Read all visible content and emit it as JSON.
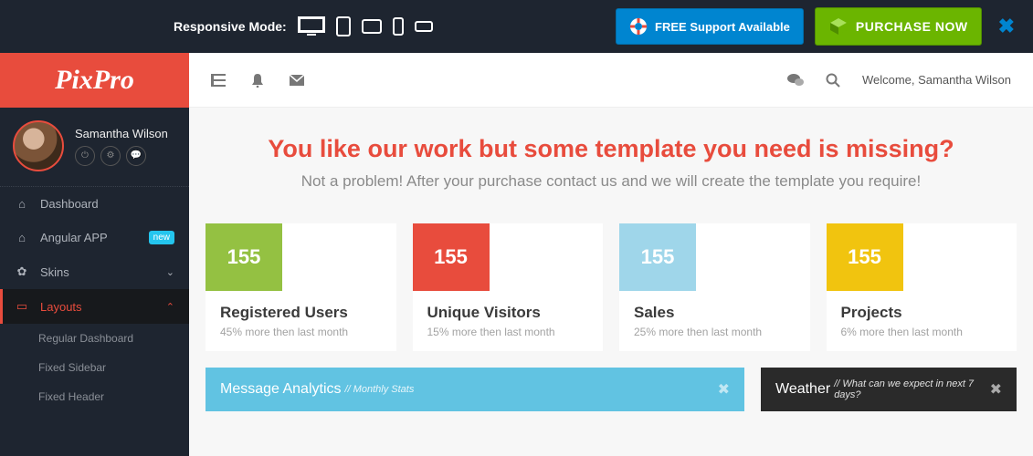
{
  "topbar": {
    "responsive_label": "Responsive Mode:",
    "support_btn": "FREE Support Available",
    "purchase_btn": "PURCHASE NOW"
  },
  "logo": "PixPro",
  "header": {
    "welcome": "Welcome, Samantha Wilson"
  },
  "profile": {
    "name": "Samantha Wilson"
  },
  "nav": {
    "dashboard": "Dashboard",
    "angular": "Angular APP",
    "angular_badge": "new",
    "skins": "Skins",
    "layouts": "Layouts",
    "sub": {
      "regular": "Regular Dashboard",
      "fixed_sidebar": "Fixed Sidebar",
      "fixed_header": "Fixed Header"
    }
  },
  "promo": {
    "title": "You like our work but some template you need is missing?",
    "sub": "Not a problem! After your purchase contact us and we will create the template you require!"
  },
  "stats": [
    {
      "value": "155",
      "title": "Registered Users",
      "sub": "45% more then last month",
      "color": "c-green"
    },
    {
      "value": "155",
      "title": "Unique Visitors",
      "sub": "15% more then last month",
      "color": "c-red"
    },
    {
      "value": "155",
      "title": "Sales",
      "sub": "25% more then last month",
      "color": "c-blue"
    },
    {
      "value": "155",
      "title": "Projects",
      "sub": "6% more then last month",
      "color": "c-yellow"
    }
  ],
  "panels": {
    "analytics_title": "Message Analytics",
    "analytics_sub": " // Monthly Stats",
    "weather_title": "Weather",
    "weather_sub": " // What can we expect in next 7 days?"
  }
}
